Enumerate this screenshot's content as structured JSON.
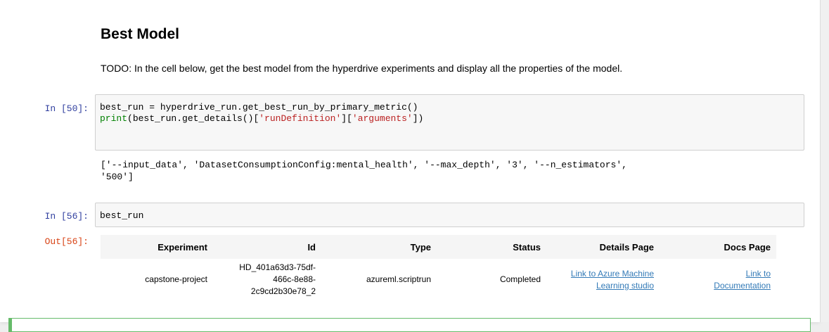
{
  "markdown": {
    "title": "Best Model",
    "text": "TODO: In the cell below, get the best model from the hyperdrive experiments and display all the properties of the model."
  },
  "cell1": {
    "prompt_in": "In [50]:",
    "code_line1_a": "best_run = hyperdrive_run.get_best_run_by_primary_metric()",
    "code_line2_print": "print",
    "code_line2_b": "(best_run.get_details()[",
    "code_line2_str1": "'runDefinition'",
    "code_line2_c": "][",
    "code_line2_str2": "'arguments'",
    "code_line2_d": "])",
    "output_line1": "['--input_data', 'DatasetConsumptionConfig:mental_health', '--max_depth', '3', '--n_estimators',",
    "output_line2": "'500']"
  },
  "cell2": {
    "prompt_in": "In [56]:",
    "code": "best_run",
    "prompt_out": "Out[56]:"
  },
  "run_table": {
    "headers": [
      "Experiment",
      "Id",
      "Type",
      "Status",
      "Details Page",
      "Docs Page"
    ],
    "row": {
      "experiment": "capstone-project",
      "id_line1": "HD_401a63d3-75df-",
      "id_line2": "466c-8e88-",
      "id_line3": "2c9cd2b30e78_2",
      "type": "azureml.scriptrun",
      "status": "Completed",
      "details_line1": "Link to Azure Machine",
      "details_line2": "Learning studio",
      "docs_line1": "Link to",
      "docs_line2": "Documentation"
    }
  }
}
